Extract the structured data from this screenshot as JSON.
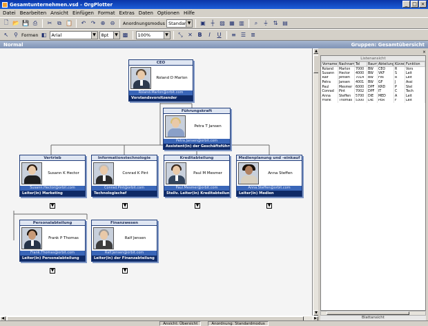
{
  "window": {
    "title": "Gesamtunternehmen.vsd - OrgPlotter"
  },
  "menu": [
    "Datei",
    "Bearbeiten",
    "Ansicht",
    "Einfügen",
    "Format",
    "Extras",
    "Daten",
    "Optionen",
    "Hilfe"
  ],
  "toolbar": {
    "font_name": "Arial",
    "font_size": "8pt",
    "layout_label": "Anordnungsmodus",
    "layout_value": "Standard",
    "zoom_value": "100%",
    "shape_label": "Formen"
  },
  "strip": {
    "left": "Normal",
    "right": "Gruppen: Gesamtübersicht"
  },
  "icons": [
    "new-icon",
    "open-icon",
    "save-icon",
    "print-icon",
    "cut-icon",
    "copy-icon",
    "paste-icon",
    "undo-icon",
    "redo-icon",
    "zoom-in-icon",
    "zoom-out-icon",
    "bold-icon",
    "italic-icon",
    "underline-icon",
    "align-left-icon",
    "align-center-icon",
    "align-right-icon"
  ],
  "colors": {
    "node_border": "#1f3c7a",
    "role_bar": "#0f2a66",
    "mail_bar": "#3a66b8",
    "title_bar": "#0a36a8"
  },
  "org": {
    "ceo": {
      "title": "CEO",
      "name": "Roland D Marlon",
      "email": "Roland.Marlon@orbit.com",
      "role": "Vorstandsvorsitzender"
    },
    "assistant": {
      "title": "Führungskraft",
      "name": "Petra T Jansen",
      "email": "Petra.Jansen@orbit.com",
      "role": "Assistent(in) der Geschäftsführung"
    },
    "level2": [
      {
        "title": "Vertrieb",
        "name": "Susann K Hector",
        "email": "Susann.Hector@orbit.com",
        "role": "Leiter(in) Marketing"
      },
      {
        "title": "Informationstechnologie",
        "name": "Conrad K Pint",
        "email": "Conrad.Pint@orbit.com",
        "role": "Technologiechef"
      },
      {
        "title": "Kreditabteilung",
        "name": "Paul M Mesmer",
        "email": "Paul.Mesmer@orbit.com",
        "role": "Stellv. Leiter(in) Kreditabteilung"
      },
      {
        "title": "Medienplanung und -einkauf",
        "name": "Anna Steffen",
        "email": "Anna.Steffen@orbit.com",
        "role": "Leiter(in) Medien"
      }
    ],
    "level3": [
      {
        "title": "Personalabteilung",
        "name": "Frank P Thomas",
        "email": "Frank.Thomas@orbit.com",
        "role": "Leiter(in) Personalabteilung"
      },
      {
        "title": "Finanzwesen",
        "name": "Ralf Jensen",
        "email": "Ralf.Jensen@orbit.com",
        "role": "Leiter(in) der Finanzabteilung"
      }
    ]
  },
  "grid": {
    "title": "Listenansicht",
    "columns": [
      "Vorname",
      "Nachname",
      "Tel",
      "Raum",
      "Abteilung",
      "Kürzel",
      "Funktion"
    ],
    "rows": [
      [
        "Roland",
        "Marlon",
        "7000",
        "BW",
        "CEO",
        "R",
        "Vors"
      ],
      [
        "Susann",
        "Hector",
        "4000",
        "BW",
        "VKF",
        "S",
        "Leit"
      ],
      [
        "Ralf",
        "Jensen",
        "7014",
        "BW",
        "FIN",
        "R",
        "Leit"
      ],
      [
        "Petra",
        "Jansen",
        "4001",
        "BW",
        "GF",
        "J",
        "Assi"
      ],
      [
        "Paul",
        "Mesmer",
        "6000",
        "DPF",
        "KRD",
        "P",
        "Stel"
      ],
      [
        "Conrad",
        "Pint",
        "7002",
        "DPF",
        "IT",
        "C",
        "Tech"
      ],
      [
        "Anna",
        "Steffen",
        "5700",
        "DIE",
        "MED",
        "A",
        "Leit"
      ],
      [
        "Frank",
        "Thomas",
        "5300",
        "DIE",
        "PER",
        "F",
        "Leit"
      ]
    ],
    "footer": "Blattansicht"
  },
  "status": [
    "Ansicht: Übersicht",
    "Anordnung: Standardmodus"
  ]
}
